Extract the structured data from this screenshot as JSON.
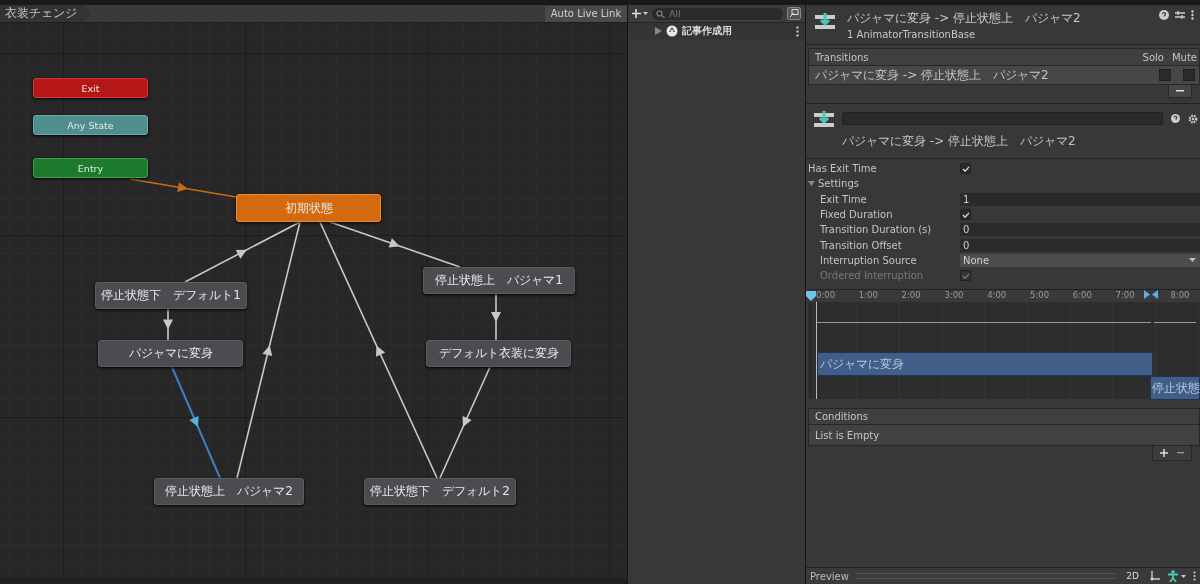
{
  "graph": {
    "breadcrumb": "衣装チェンジ",
    "live_link_button": "Auto Live Link",
    "states": [
      {
        "label": "Exit",
        "kind": "exit"
      },
      {
        "label": "Any State",
        "kind": "any"
      },
      {
        "label": "Entry",
        "kind": "entry"
      },
      {
        "label": "初期状態",
        "kind": "default"
      },
      {
        "label": "停止状態下　デフォルト1",
        "kind": "state"
      },
      {
        "label": "パジャマに変身",
        "kind": "state"
      },
      {
        "label": "停止状態上　パジャマ1",
        "kind": "state"
      },
      {
        "label": "デフォルト衣装に変身",
        "kind": "state"
      },
      {
        "label": "停止状態上　パジャマ2",
        "kind": "state"
      },
      {
        "label": "停止状態下　デフォルト2",
        "kind": "state"
      }
    ],
    "transitions": [
      {
        "selected": false
      },
      {
        "selected": false
      },
      {
        "selected": false
      },
      {
        "selected": true
      },
      {
        "selected": false
      },
      {
        "selected": false
      },
      {
        "selected": false
      },
      {
        "selected": false
      },
      {
        "selected": false
      }
    ]
  },
  "hierarchy": {
    "search": {
      "placeholder": "All"
    },
    "items": [
      {
        "label": "記事作成用",
        "expanded": false
      }
    ]
  },
  "inspector": {
    "title": "パジャマに変身 -> 停止状態上　パジャマ2",
    "subtitle": "1 AnimatorTransitionBase",
    "transitions_list": {
      "header": "Transitions",
      "solo_label": "Solo",
      "mute_label": "Mute",
      "rows": [
        {
          "label": "パジャマに変身 -> 停止状態上　パジャマ2",
          "solo": false,
          "mute": false
        }
      ]
    },
    "transition_label": "パジャマに変身 -> 停止状態上　パジャマ2",
    "properties": [
      {
        "kind": "checkbox",
        "label": "Has Exit Time",
        "checked": true,
        "disabled": false
      },
      {
        "kind": "foldout",
        "label": "Settings",
        "expanded": true,
        "children": [
          {
            "kind": "number",
            "label": "Exit Time",
            "value": "1"
          },
          {
            "kind": "checkbox",
            "label": "Fixed Duration",
            "checked": true,
            "disabled": false
          },
          {
            "kind": "number",
            "label": "Transition Duration (s)",
            "value": "0"
          },
          {
            "kind": "number",
            "label": "Transition Offset",
            "value": "0"
          },
          {
            "kind": "dropdown",
            "label": "Interruption Source",
            "value": "None"
          },
          {
            "kind": "checkbox",
            "label": "Ordered Interruption",
            "checked": true,
            "disabled": true
          }
        ]
      }
    ],
    "timeline": {
      "ticks": [
        "0:00",
        "1:00",
        "2:00",
        "3:00",
        "4:00",
        "5:00",
        "6:00",
        "7:00",
        "8:00"
      ],
      "clips": [
        "パジャマに変身",
        "停止状態"
      ]
    },
    "conditions": {
      "header": "Conditions",
      "empty_text": "List is Empty"
    },
    "preview": {
      "label": "Preview",
      "mode_button": "2D"
    }
  }
}
